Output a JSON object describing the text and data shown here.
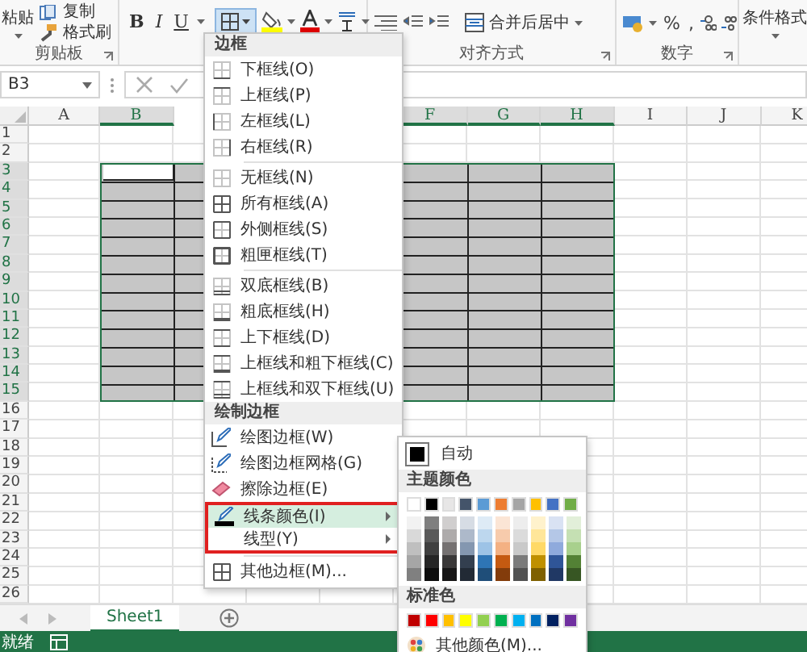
{
  "ribbon": {
    "clipboard": {
      "paste": "粘贴",
      "copy": "复制",
      "format_painter": "格式刷",
      "label": "剪贴板"
    },
    "font": {
      "bold": "B",
      "italic": "I",
      "underline": "U",
      "border_button": {
        "active": true
      }
    },
    "alignment": {
      "merge": "合并后居中",
      "label": "对齐方式"
    },
    "number": {
      "percent": "%",
      "comma": ",",
      "label": "数字"
    },
    "styles": {
      "conditional_format": "条件格式"
    }
  },
  "formula_bar": {
    "name_box": "B3"
  },
  "sheet": {
    "columns": [
      {
        "label": "A",
        "selected": false
      },
      {
        "label": "B",
        "selected": true
      },
      {},
      {},
      {},
      {
        "label": "F",
        "selected": true
      },
      {
        "label": "G",
        "selected": true
      },
      {
        "label": "H",
        "selected": true
      },
      {
        "label": "I",
        "selected": false
      },
      {
        "label": "J",
        "selected": false
      },
      {
        "label": "K",
        "selected": false
      }
    ],
    "rows": [
      {
        "label": "1",
        "selected": false
      },
      {
        "label": "2",
        "selected": false
      },
      {
        "label": "3",
        "selected": true
      },
      {
        "label": "4",
        "selected": true
      },
      {
        "label": "5",
        "selected": true
      },
      {
        "label": "6",
        "selected": true
      },
      {
        "label": "7",
        "selected": true
      },
      {
        "label": "8",
        "selected": true
      },
      {
        "label": "9",
        "selected": true
      },
      {
        "label": "10",
        "selected": true
      },
      {
        "label": "11",
        "selected": true
      },
      {
        "label": "12",
        "selected": true
      },
      {
        "label": "13",
        "selected": true
      },
      {
        "label": "14",
        "selected": true
      },
      {
        "label": "15",
        "selected": true
      },
      {
        "label": "16",
        "selected": false
      },
      {
        "label": "17",
        "selected": false
      },
      {
        "label": "18",
        "selected": false
      },
      {
        "label": "19",
        "selected": false
      },
      {
        "label": "20",
        "selected": false
      },
      {
        "label": "21",
        "selected": false
      },
      {
        "label": "22",
        "selected": false
      },
      {
        "label": "23",
        "selected": false
      },
      {
        "label": "24",
        "selected": false
      },
      {
        "label": "25",
        "selected": false
      },
      {
        "label": "26",
        "selected": false
      }
    ]
  },
  "border_menu": {
    "items": [
      {
        "kind": "header",
        "label": "边框"
      },
      {
        "kind": "item",
        "label": "下框线(O)",
        "selected": false,
        "highlighted": false
      },
      {
        "kind": "item",
        "label": "上框线(P)",
        "selected": false,
        "highlighted": false
      },
      {
        "kind": "item",
        "label": "左框线(L)",
        "selected": false,
        "highlighted": false
      },
      {
        "kind": "item",
        "label": "右框线(R)",
        "selected": false,
        "highlighted": false
      },
      {
        "kind": "separator"
      },
      {
        "kind": "item",
        "label": "无框线(N)",
        "selected": false,
        "highlighted": false
      },
      {
        "kind": "item",
        "label": "所有框线(A)",
        "selected": false,
        "highlighted": false
      },
      {
        "kind": "item",
        "label": "外侧框线(S)",
        "selected": false,
        "highlighted": false
      },
      {
        "kind": "item",
        "label": "粗匣框线(T)",
        "selected": false,
        "highlighted": false
      },
      {
        "kind": "separator"
      },
      {
        "kind": "item",
        "label": "双底框线(B)",
        "selected": false,
        "highlighted": false
      },
      {
        "kind": "item",
        "label": "粗底框线(H)",
        "selected": false,
        "highlighted": false
      },
      {
        "kind": "item",
        "label": "上下框线(D)",
        "selected": false,
        "highlighted": false
      },
      {
        "kind": "item",
        "label": "上框线和粗下框线(C)",
        "selected": false,
        "highlighted": false
      },
      {
        "kind": "item",
        "label": "上框线和双下框线(U)",
        "selected": false,
        "highlighted": false
      },
      {
        "kind": "header",
        "label": "绘制边框"
      },
      {
        "kind": "item",
        "label": "绘图边框(W)",
        "selected": false,
        "highlighted": false
      },
      {
        "kind": "item",
        "label": "绘图边框网格(G)",
        "selected": false,
        "highlighted": false
      },
      {
        "kind": "item",
        "label": "擦除边框(E)",
        "selected": false,
        "highlighted": false
      },
      {
        "kind": "submenu",
        "label": "线条颜色(I)",
        "selected": true,
        "highlighted": true
      },
      {
        "kind": "submenu",
        "label": "线型(Y)",
        "selected": false,
        "highlighted": true
      },
      {
        "kind": "separator"
      },
      {
        "kind": "item",
        "label": "其他边框(M)...",
        "selected": false,
        "highlighted": false
      }
    ]
  },
  "line_color_menu": {
    "automatic": {
      "label": "自动",
      "color": "#000000"
    },
    "theme_header": "主题颜色",
    "theme_colors": [
      {
        "color": "#ffffff",
        "shades": [
          {
            "color": "#f2f2f2"
          },
          {
            "color": "#d9d9d9"
          },
          {
            "color": "#bfbfbf"
          },
          {
            "color": "#a6a6a6"
          },
          {
            "color": "#808080"
          }
        ]
      },
      {
        "color": "#000000",
        "shades": [
          {
            "color": "#7f7f7f"
          },
          {
            "color": "#595959"
          },
          {
            "color": "#404040"
          },
          {
            "color": "#262626"
          },
          {
            "color": "#0d0d0d"
          }
        ]
      },
      {
        "color": "#e7e6e6",
        "shades": [
          {
            "color": "#d0cece"
          },
          {
            "color": "#aeabab"
          },
          {
            "color": "#757171"
          },
          {
            "color": "#3a3838"
          },
          {
            "color": "#171616"
          }
        ]
      },
      {
        "color": "#44546a",
        "shades": [
          {
            "color": "#d6dce4"
          },
          {
            "color": "#adb9ca"
          },
          {
            "color": "#8497b0"
          },
          {
            "color": "#333f4f"
          },
          {
            "color": "#222a35"
          }
        ]
      },
      {
        "color": "#5b9bd5",
        "shades": [
          {
            "color": "#deebf6"
          },
          {
            "color": "#bdd7ee"
          },
          {
            "color": "#9dc3e6"
          },
          {
            "color": "#2e75b5"
          },
          {
            "color": "#1f4e79"
          }
        ]
      },
      {
        "color": "#ed7d31",
        "shades": [
          {
            "color": "#fbe5d5"
          },
          {
            "color": "#f7cbac"
          },
          {
            "color": "#f4b183"
          },
          {
            "color": "#c55a11"
          },
          {
            "color": "#833c0b"
          }
        ]
      },
      {
        "color": "#a5a5a5",
        "shades": [
          {
            "color": "#ededed"
          },
          {
            "color": "#dbdbdb"
          },
          {
            "color": "#c9c9c9"
          },
          {
            "color": "#7b7b7b"
          },
          {
            "color": "#525252"
          }
        ]
      },
      {
        "color": "#ffc000",
        "shades": [
          {
            "color": "#fff2cc"
          },
          {
            "color": "#ffe699"
          },
          {
            "color": "#ffd966"
          },
          {
            "color": "#bf9000"
          },
          {
            "color": "#7f6000"
          }
        ]
      },
      {
        "color": "#4472c4",
        "shades": [
          {
            "color": "#d9e2f3"
          },
          {
            "color": "#b4c7e7"
          },
          {
            "color": "#8faadc"
          },
          {
            "color": "#2f5597"
          },
          {
            "color": "#203864"
          }
        ]
      },
      {
        "color": "#70ad47",
        "shades": [
          {
            "color": "#e2efd9"
          },
          {
            "color": "#c5e0b3"
          },
          {
            "color": "#a8d08d"
          },
          {
            "color": "#538135"
          },
          {
            "color": "#375623"
          }
        ]
      }
    ],
    "standard_header": "标准色",
    "standard_colors": [
      {
        "color": "#c00000"
      },
      {
        "color": "#ff0000"
      },
      {
        "color": "#ffc000"
      },
      {
        "color": "#ffff00"
      },
      {
        "color": "#92d050"
      },
      {
        "color": "#00b050"
      },
      {
        "color": "#00b0f0"
      },
      {
        "color": "#0070c0"
      },
      {
        "color": "#002060"
      },
      {
        "color": "#7030a0"
      }
    ],
    "more": "其他颜色(M)..."
  },
  "sheet_tabs": [
    {
      "label": "Sheet1",
      "selected": true
    }
  ],
  "status_bar": {
    "text": "就绪"
  }
}
